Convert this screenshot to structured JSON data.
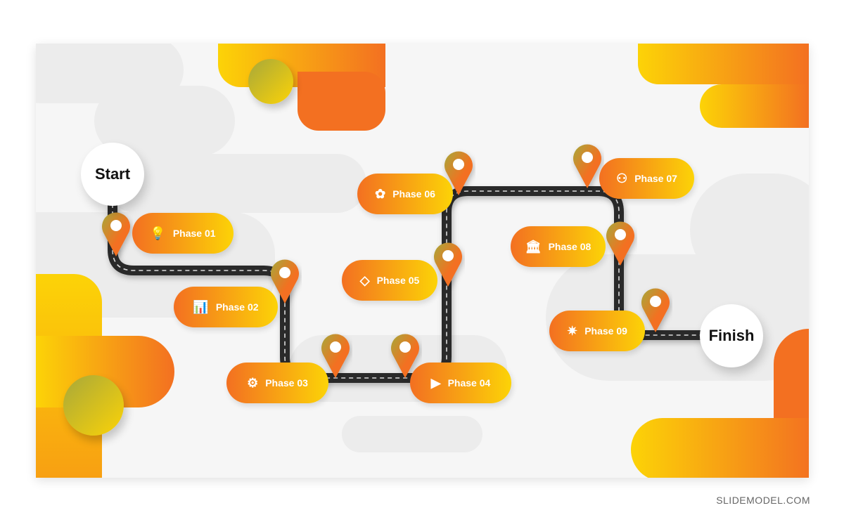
{
  "start_label": "Start",
  "finish_label": "Finish",
  "phases": [
    {
      "label": "Phase 01",
      "icon": "lightbulb-icon",
      "glyph": "💡"
    },
    {
      "label": "Phase 02",
      "icon": "bar-chart-icon",
      "glyph": "📊"
    },
    {
      "label": "Phase 03",
      "icon": "gears-icon",
      "glyph": "⚙"
    },
    {
      "label": "Phase 04",
      "icon": "presentation-icon",
      "glyph": "▶"
    },
    {
      "label": "Phase 05",
      "icon": "diamond-icon",
      "glyph": "◇"
    },
    {
      "label": "Phase 06",
      "icon": "team-icon",
      "glyph": "✿"
    },
    {
      "label": "Phase 07",
      "icon": "meeting-icon",
      "glyph": "⚇"
    },
    {
      "label": "Phase 08",
      "icon": "bank-icon",
      "glyph": "🏛"
    },
    {
      "label": "Phase 09",
      "icon": "sparkle-icon",
      "glyph": "✷"
    }
  ],
  "colors": {
    "orange": "#f37021",
    "yellow": "#fcd307",
    "road": "#2b2b2b",
    "background": "#f6f6f6"
  },
  "brand": "SLIDEMODEL.COM"
}
